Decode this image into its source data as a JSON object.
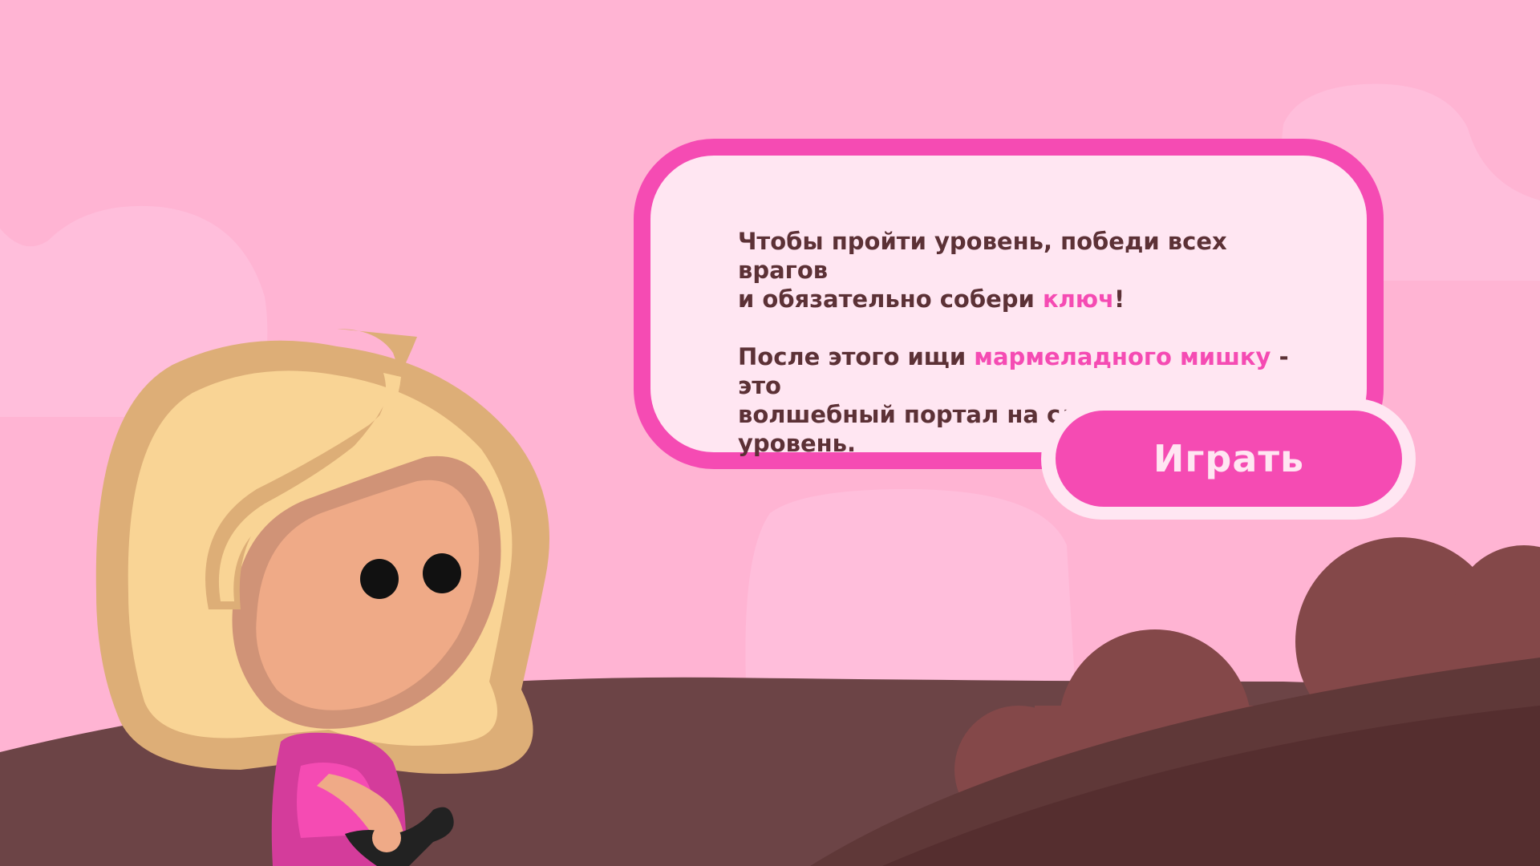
{
  "dialog": {
    "line1_part1": "Чтобы пройти уровень, победи всех врагов",
    "line2_part1": "и обязательно собери ",
    "line2_highlight": "ключ",
    "line2_end": "!",
    "line3_part1": "После этого ищи ",
    "line3_highlight": "мармеладного мишку",
    "line3_part2": " - это",
    "line4": "волшебный портал на следующий уровень."
  },
  "play_button": {
    "label": "Играть"
  },
  "colors": {
    "sky": "#FFB4D3",
    "accent": "#F54BB3",
    "bubble_fill": "#FFE6F2",
    "text": "#5C3136",
    "ground": "#6C4446"
  },
  "icons": {
    "character": "girl-character-icon"
  }
}
